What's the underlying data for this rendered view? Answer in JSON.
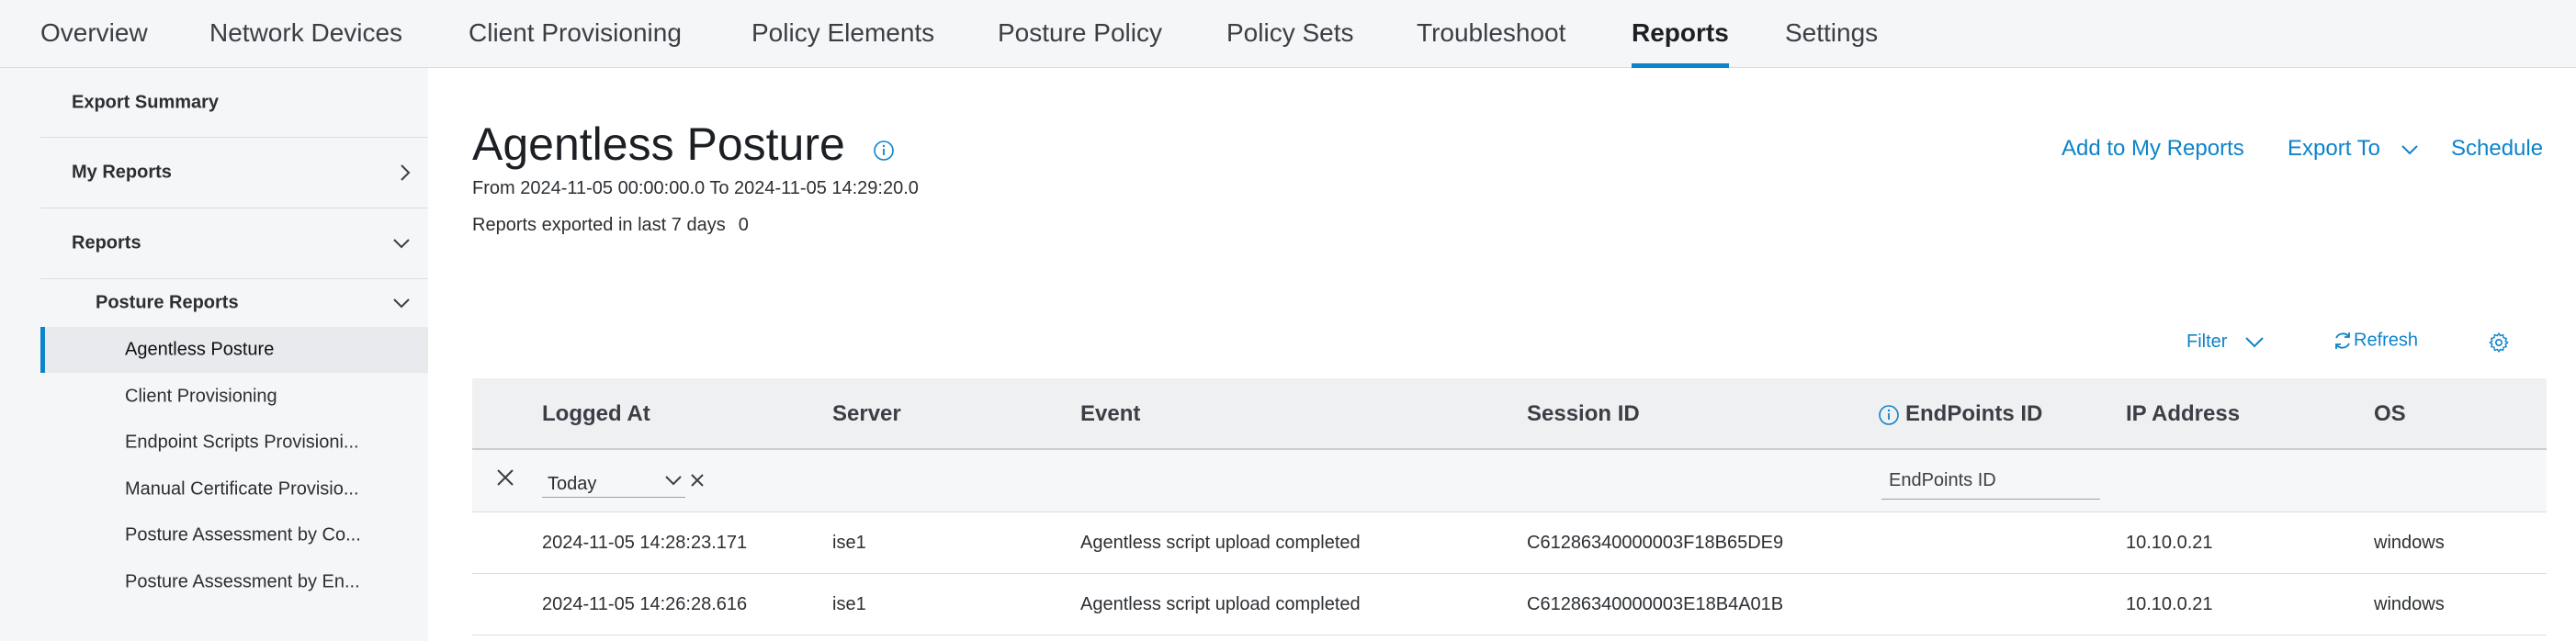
{
  "topnav": {
    "tabs": [
      {
        "label": "Overview"
      },
      {
        "label": "Network Devices"
      },
      {
        "label": "Client Provisioning"
      },
      {
        "label": "Policy Elements"
      },
      {
        "label": "Posture Policy"
      },
      {
        "label": "Policy Sets"
      },
      {
        "label": "Troubleshoot"
      },
      {
        "label": "Reports"
      },
      {
        "label": "Settings"
      }
    ],
    "active_tab": "Reports"
  },
  "sidebar": {
    "export_summary": "Export Summary",
    "my_reports": "My Reports",
    "reports": "Reports",
    "posture_reports": "Posture Reports",
    "items": [
      {
        "label": "Agentless Posture"
      },
      {
        "label": "Client Provisioning"
      },
      {
        "label": "Endpoint Scripts Provisioni..."
      },
      {
        "label": "Manual Certificate Provisio..."
      },
      {
        "label": "Posture Assessment by Co..."
      },
      {
        "label": "Posture Assessment by En..."
      }
    ]
  },
  "main": {
    "title": "Agentless Posture",
    "date_range": "From 2024-11-05 00:00:00.0 To 2024-11-05 14:29:20.0",
    "exported_label": "Reports exported in last 7 days",
    "exported_count": "0",
    "actions": {
      "add_to_my_reports": "Add to My Reports",
      "export_to": "Export To",
      "schedule": "Schedule"
    },
    "filter_label": "Filter",
    "refresh_label": "Refresh"
  },
  "table": {
    "columns": [
      "Logged At",
      "Server",
      "Event",
      "Session ID",
      "EndPoints ID",
      "IP Address",
      "OS"
    ],
    "filter": {
      "date_value": "Today",
      "endpoints_placeholder": "EndPoints ID"
    },
    "rows": [
      {
        "logged_at": "2024-11-05 14:28:23.171",
        "server": "ise1",
        "event": "Agentless script upload completed",
        "session_id": "C61286340000003F18B65DE9",
        "endpoints_id": "",
        "ip": "10.10.0.21",
        "os": "windows"
      },
      {
        "logged_at": "2024-11-05 14:26:28.616",
        "server": "ise1",
        "event": "Agentless script upload completed",
        "session_id": "C61286340000003E18B4A01B",
        "endpoints_id": "",
        "ip": "10.10.0.21",
        "os": "windows"
      }
    ]
  },
  "colors": {
    "accent": "#0d83c9",
    "background": "#f5f6f7",
    "header_bg": "#eef0f2"
  },
  "icons": [
    "chevron-right-icon",
    "chevron-down-icon",
    "info-icon",
    "refresh-icon",
    "gear-icon",
    "close-icon"
  ]
}
